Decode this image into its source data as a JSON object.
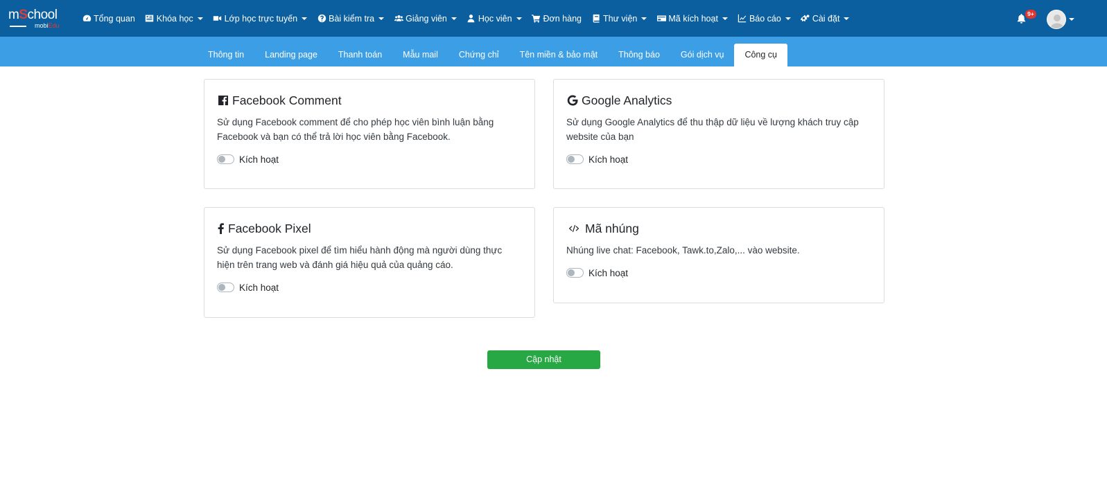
{
  "brand": {
    "logo_text_a": "m",
    "logo_text_s": "S",
    "logo_text_b": "chool",
    "logo_sub_a": "mobi",
    "logo_sub_b": "Edu",
    "accent_red": "#e03a3a"
  },
  "colors": {
    "topbar": "#0b5f9e",
    "subbar": "#3c9ee5",
    "primary_button": "#28a745",
    "badge": "#e3342f"
  },
  "nav": {
    "items": [
      {
        "label": "Tổng quan",
        "icon": "dashboard-icon",
        "dropdown": false
      },
      {
        "label": "Khóa học",
        "icon": "course-icon",
        "dropdown": true
      },
      {
        "label": "Lớp học trực tuyến",
        "icon": "video-icon",
        "dropdown": true
      },
      {
        "label": "Bài kiểm tra",
        "icon": "question-circle-icon",
        "dropdown": true
      },
      {
        "label": "Giảng viên",
        "icon": "users-icon",
        "dropdown": true
      },
      {
        "label": "Học viên",
        "icon": "user-icon",
        "dropdown": true
      },
      {
        "label": "Đơn hàng",
        "icon": "cart-icon",
        "dropdown": false
      },
      {
        "label": "Thư viện",
        "icon": "book-icon",
        "dropdown": true
      },
      {
        "label": "Mã kích hoạt",
        "icon": "card-icon",
        "dropdown": true
      },
      {
        "label": "Báo cáo",
        "icon": "chart-line-icon",
        "dropdown": true
      },
      {
        "label": "Cài đặt",
        "icon": "gears-icon",
        "dropdown": true
      }
    ],
    "notification_badge": "9+"
  },
  "tabs": [
    {
      "label": "Thông tin",
      "active": false
    },
    {
      "label": "Landing page",
      "active": false
    },
    {
      "label": "Thanh toán",
      "active": false
    },
    {
      "label": "Mẫu mail",
      "active": false
    },
    {
      "label": "Chứng chỉ",
      "active": false
    },
    {
      "label": "Tên miền & bảo mật",
      "active": false
    },
    {
      "label": "Thông báo",
      "active": false
    },
    {
      "label": "Gói dịch vụ",
      "active": false
    },
    {
      "label": "Công cụ",
      "active": true
    }
  ],
  "cards": {
    "fb_comment": {
      "title": "Facebook Comment",
      "icon": "facebook-square-icon",
      "description": "Sử dụng Facebook comment để cho phép học viên bình luận bằng Facebook và bạn có thể trả lời học viên bằng Facebook.",
      "toggle_label": "Kích hoạt",
      "enabled": false
    },
    "google_analytics": {
      "title": "Google Analytics",
      "icon": "google-icon",
      "description": "Sử dụng Google Analytics để thu thập dữ liệu về lượng khách truy cập website của bạn",
      "toggle_label": "Kích hoạt",
      "enabled": false
    },
    "fb_pixel": {
      "title": "Facebook Pixel",
      "icon": "facebook-f-icon",
      "description": "Sử dụng Facebook pixel để tìm hiểu hành động mà người dùng thực hiện trên trang web và đánh giá hiệu quả của quảng cáo.",
      "toggle_label": "Kích hoạt",
      "enabled": false
    },
    "embed_code": {
      "title": "Mã nhúng",
      "icon": "code-icon",
      "description": "Nhúng live chat: Facebook, Tawk.to,Zalo,... vào website.",
      "toggle_label": "Kích hoạt",
      "enabled": false
    }
  },
  "submit_label": "Cập nhật"
}
